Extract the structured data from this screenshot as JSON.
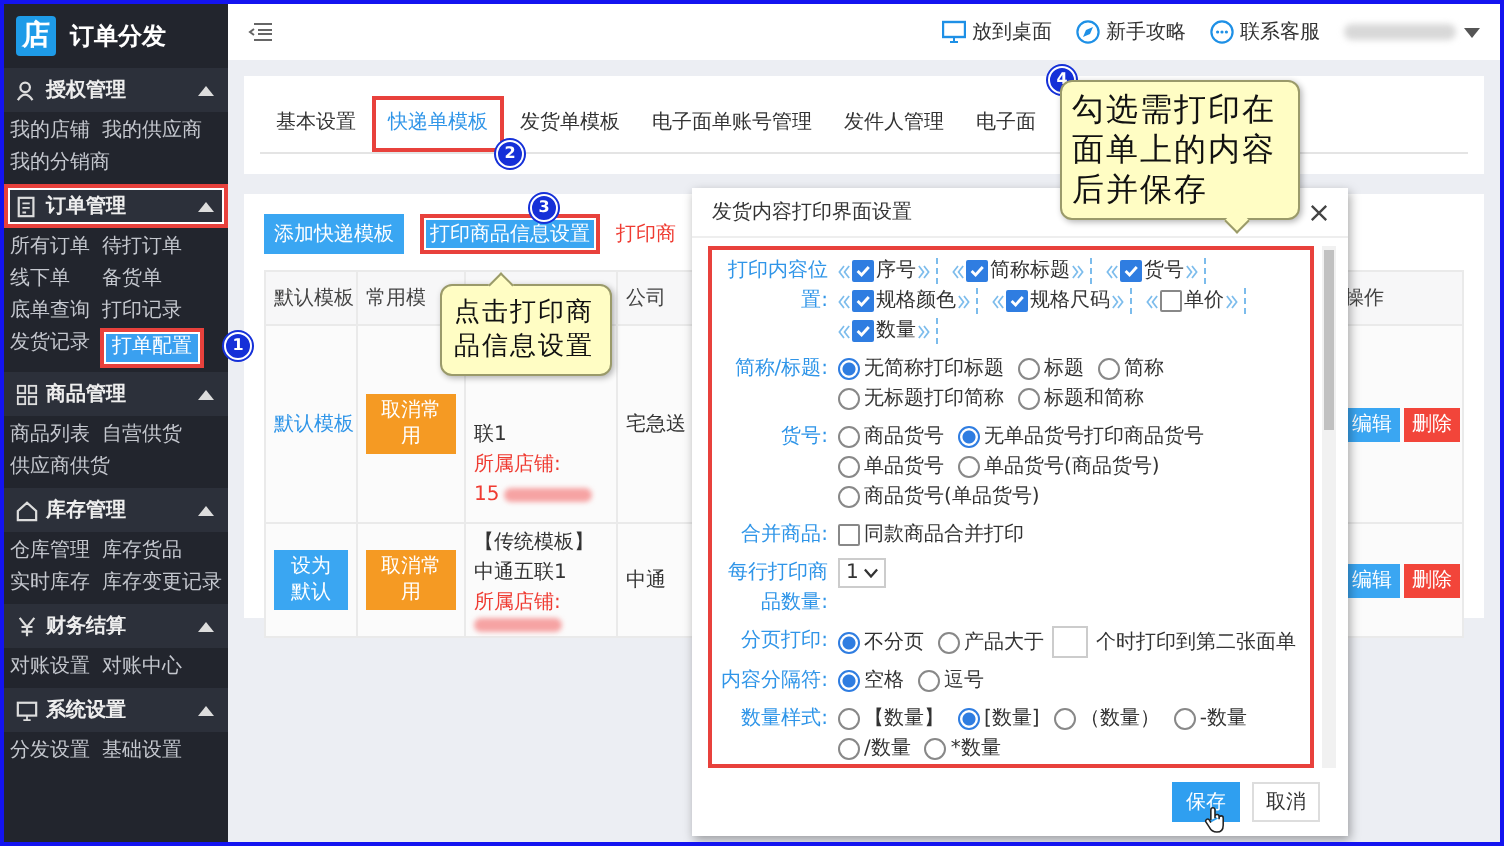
{
  "sidebar": {
    "logo": "店",
    "app_name": "订单分发",
    "sections": [
      {
        "title": "授权管理",
        "expanded": true,
        "highlighted": false,
        "items": [
          {
            "label": "我的店铺",
            "selected": false,
            "highlighted": false
          },
          {
            "label": "我的供应商",
            "selected": false,
            "highlighted": false
          },
          {
            "label": "我的分销商",
            "selected": false,
            "highlighted": false
          }
        ]
      },
      {
        "title": "订单管理",
        "expanded": true,
        "highlighted": true,
        "items": [
          {
            "label": "所有订单",
            "selected": false,
            "highlighted": false
          },
          {
            "label": "待打订单",
            "selected": false,
            "highlighted": false
          },
          {
            "label": "线下单",
            "selected": false,
            "highlighted": false
          },
          {
            "label": "备货单",
            "selected": false,
            "highlighted": false
          },
          {
            "label": "底单查询",
            "selected": false,
            "highlighted": false
          },
          {
            "label": "打印记录",
            "selected": false,
            "highlighted": false
          },
          {
            "label": "发货记录",
            "selected": false,
            "highlighted": false
          },
          {
            "label": "打单配置",
            "selected": true,
            "highlighted": true,
            "step": "1"
          }
        ]
      },
      {
        "title": "商品管理",
        "expanded": true,
        "highlighted": false,
        "items": [
          {
            "label": "商品列表",
            "selected": false,
            "highlighted": false
          },
          {
            "label": "自营供货",
            "selected": false,
            "highlighted": false
          },
          {
            "label": "供应商供货",
            "selected": false,
            "highlighted": false
          }
        ]
      },
      {
        "title": "库存管理",
        "expanded": true,
        "highlighted": false,
        "items": [
          {
            "label": "仓库管理",
            "selected": false,
            "highlighted": false
          },
          {
            "label": "库存货品",
            "selected": false,
            "highlighted": false
          },
          {
            "label": "实时库存",
            "selected": false,
            "highlighted": false
          },
          {
            "label": "库存变更记录",
            "selected": false,
            "highlighted": false
          }
        ]
      },
      {
        "title": "财务结算",
        "expanded": true,
        "highlighted": false,
        "items": [
          {
            "label": "对账设置",
            "selected": false,
            "highlighted": false
          },
          {
            "label": "对账中心",
            "selected": false,
            "highlighted": false
          }
        ]
      },
      {
        "title": "系统设置",
        "expanded": true,
        "highlighted": false,
        "items": [
          {
            "label": "分发设置",
            "selected": false,
            "highlighted": false
          },
          {
            "label": "基础设置",
            "selected": false,
            "highlighted": false
          }
        ]
      }
    ]
  },
  "header": {
    "links": [
      {
        "label": "放到桌面"
      },
      {
        "label": "新手攻略"
      },
      {
        "label": "联系客服"
      }
    ],
    "username_redacted": true
  },
  "tabs": [
    {
      "label": "基本设置",
      "selected": false,
      "highlighted": false
    },
    {
      "label": "快递单模板",
      "selected": true,
      "highlighted": true,
      "step": "2"
    },
    {
      "label": "发货单模板",
      "selected": false,
      "highlighted": false
    },
    {
      "label": "电子面单账号管理",
      "selected": false,
      "highlighted": false
    },
    {
      "label": "发件人管理",
      "selected": false,
      "highlighted": false
    },
    {
      "label": "电子面",
      "selected": false,
      "highlighted": false
    }
  ],
  "templates": {
    "buttons": [
      {
        "label": "添加快递模板",
        "highlighted": false
      },
      {
        "label": "打印商品信息设置",
        "highlighted": true,
        "step": "3"
      }
    ],
    "notice": "打印商",
    "columns": [
      {
        "label": "默认模板"
      },
      {
        "label": "常用模"
      },
      {},
      {
        "label": "公司"
      },
      {},
      {
        "label": "操作"
      }
    ],
    "rows": [
      {
        "default_cell": {
          "kind": "link",
          "label": "默认模板"
        },
        "common_action": "取消常用",
        "template_name": "联1",
        "shop_label": "所属店铺:",
        "shop_value": "15",
        "shop_redacted": true,
        "company": "宅急送",
        "actions": [
          {
            "label": "编辑",
            "kind": "edit"
          },
          {
            "label": "删除",
            "kind": "delete"
          }
        ]
      },
      {
        "default_cell": {
          "kind": "button",
          "label": "设为默认"
        },
        "common_action": "取消常用",
        "template_name": "【传统模板】中通五联1",
        "shop_label": "所属店铺:",
        "shop_redacted": true,
        "company": "中通",
        "actions": [
          {
            "label": "编辑",
            "kind": "edit"
          },
          {
            "label": "删除",
            "kind": "delete"
          }
        ]
      }
    ]
  },
  "dialog": {
    "title": "发货内容打印界面设置",
    "body_highlighted": true,
    "fields": [
      {
        "kind": "order",
        "label": "打印内容位置:",
        "items": [
          {
            "label": "序号",
            "checked": true
          },
          {
            "label": "简称标题",
            "checked": true
          },
          {
            "label": "货号",
            "checked": true
          },
          {
            "label": "规格颜色",
            "checked": true
          },
          {
            "label": "规格尺码",
            "checked": true
          },
          {
            "label": "单价",
            "checked": false
          },
          {
            "label": "数量",
            "checked": true
          }
        ]
      },
      {
        "kind": "radio",
        "label": "简称/标题:",
        "options": [
          {
            "label": "无简称打印标题",
            "selected": true
          },
          {
            "label": "标题",
            "selected": false
          },
          {
            "label": "简称",
            "selected": false
          },
          {
            "label": "无标题打印简称",
            "selected": false
          },
          {
            "label": "标题和简称",
            "selected": false
          }
        ]
      },
      {
        "kind": "radio",
        "label": "货号:",
        "options": [
          {
            "label": "商品货号",
            "selected": false
          },
          {
            "label": "无单品货号打印商品货号",
            "selected": true
          },
          {
            "label": "单品货号",
            "selected": false
          },
          {
            "label": "单品货号(商品货号)",
            "selected": false
          },
          {
            "label": "商品货号(单品货号)",
            "selected": false
          }
        ]
      },
      {
        "kind": "checkbox",
        "label": "合并商品:",
        "options": [
          {
            "label": "同款商品合并打印",
            "checked": false
          }
        ]
      },
      {
        "kind": "select",
        "label": "每行打印商品数量:",
        "value": "1"
      },
      {
        "kind": "radio",
        "label": "分页打印:",
        "options": [
          {
            "label": "不分页",
            "selected": true
          },
          {
            "label": "产品大于",
            "after_field": "个时打印到第二张面单",
            "selected": false
          }
        ]
      },
      {
        "kind": "radio",
        "label": "内容分隔符:",
        "options": [
          {
            "label": "空格",
            "selected": true
          },
          {
            "label": "逗号",
            "selected": false
          }
        ]
      },
      {
        "kind": "radio",
        "label": "数量样式:",
        "options": [
          {
            "label": "【数量】",
            "selected": false
          },
          {
            "label": "[数量]",
            "selected": true
          },
          {
            "label": "（数量）",
            "selected": false
          },
          {
            "label": "-数量",
            "selected": false
          },
          {
            "label": "/数量",
            "selected": false
          },
          {
            "label": "*数量",
            "selected": false
          }
        ]
      }
    ],
    "buttons": [
      {
        "label": "保存",
        "kind": "primary"
      },
      {
        "label": "取消",
        "kind": "default"
      }
    ]
  },
  "callouts": [
    {
      "text": "点击打印商品信息设置"
    },
    {
      "text": "勾选需打印在面单上的内容后并保存",
      "step": "4"
    }
  ]
}
